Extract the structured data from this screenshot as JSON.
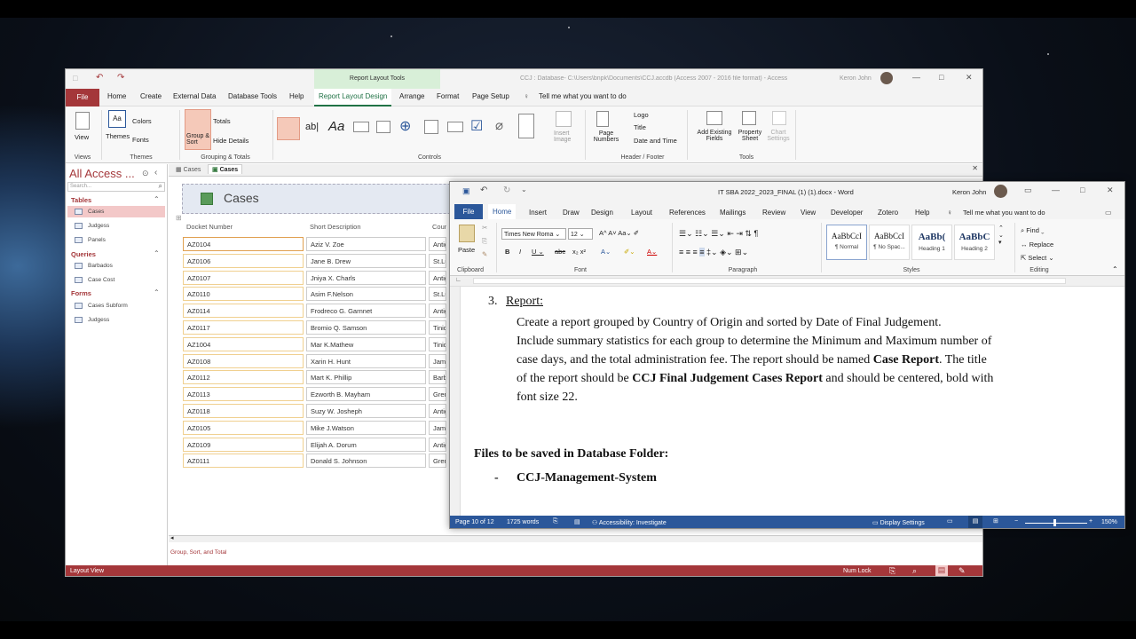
{
  "access": {
    "context_tab": "Report Layout Tools",
    "title": "CCJ : Database- C:\\Users\\bnpk\\Documents\\CCJ.accdb (Access 2007 - 2016 file format) - Access",
    "user": "Keron John",
    "tabs": [
      "File",
      "Home",
      "Create",
      "External Data",
      "Database Tools",
      "Help",
      "Report Layout Design",
      "Arrange",
      "Format",
      "Page Setup"
    ],
    "tell_me": "Tell me what you want to do",
    "ribbon": {
      "view": "View",
      "themes": "Themes",
      "colors": "Colors",
      "fonts": "Fonts",
      "group_sort": "Group & Sort",
      "totals": "Totals",
      "hide_details": "Hide Details",
      "insert_image": "Insert Image",
      "page_numbers": "Page Numbers",
      "logo": "Logo",
      "title": "Title",
      "date_time": "Date and Time",
      "add_fields": "Add Existing Fields",
      "property_sheet": "Property Sheet",
      "chart_settings": "Chart Settings",
      "groups": [
        "Views",
        "Themes",
        "Grouping & Totals",
        "Controls",
        "Header / Footer",
        "Tools"
      ]
    },
    "nav": {
      "title": "All Access ...",
      "search_placeholder": "Search...",
      "sections": [
        {
          "label": "Tables",
          "items": [
            "Cases",
            "Judgess",
            "Panels"
          ]
        },
        {
          "label": "Queries",
          "items": [
            "Barbados",
            "Case Cost"
          ]
        },
        {
          "label": "Forms",
          "items": [
            "Cases Subform",
            "Judgess"
          ]
        }
      ]
    },
    "doc_tabs": [
      "Cases",
      "Cases"
    ],
    "report": {
      "title": "Cases",
      "headers": [
        "Docket Number",
        "Short Description",
        "Coun"
      ],
      "rows": [
        [
          "AZ0104",
          "Aziz V. Zoe",
          "Antig"
        ],
        [
          "AZ0106",
          "Jane B. Drew",
          "St.Lu"
        ],
        [
          "AZ0107",
          "Jniya X. Charls",
          "Antig"
        ],
        [
          "AZ0110",
          "Asim F.Nelson",
          "St.Lu"
        ],
        [
          "AZ0114",
          "Frodreco G. Garnnet",
          "Antig"
        ],
        [
          "AZ0117",
          "Bromio Q. Samson",
          "Tinid"
        ],
        [
          "AZ1004",
          "Mar K.Mathew",
          "Tinid"
        ],
        [
          "AZ0108",
          "Xarin H. Hunt",
          "Jama"
        ],
        [
          "AZ0112",
          "Mart K. Phillip",
          "Barba"
        ],
        [
          "AZ0113",
          "Ezworth B. Mayham",
          "Gren"
        ],
        [
          "AZ0118",
          "Suzy W. Josheph",
          "Antig"
        ],
        [
          "AZ0105",
          "Mike J.Watson",
          "Jama"
        ],
        [
          "AZ0109",
          "Elijah A. Dorum",
          "Antig"
        ],
        [
          "AZ0111",
          "Donald S. Johnson",
          "Gren"
        ]
      ]
    },
    "group_sort_label": "Group, Sort, and Total",
    "status_left": "Layout View",
    "status_right": "Num Lock"
  },
  "word": {
    "title": "IT SBA 2022_2023_FINAL (1) (1).docx  -  Word",
    "user": "Keron John",
    "tabs": [
      "File",
      "Home",
      "Insert",
      "Draw",
      "Design",
      "Layout",
      "References",
      "Mailings",
      "Review",
      "View",
      "Developer",
      "Zotero",
      "Help"
    ],
    "tell_me": "Tell me what you want to do",
    "ribbon": {
      "paste": "Paste",
      "font": "Times New Roma",
      "size": "12",
      "styles": [
        {
          "sample": "AaBbCcI",
          "name": "¶ Normal"
        },
        {
          "sample": "AaBbCcI",
          "name": "¶ No Spac..."
        },
        {
          "sample": "AaBb(",
          "name": "Heading 1"
        },
        {
          "sample": "AaBbC",
          "name": "Heading 2"
        }
      ],
      "find": "Find",
      "replace": "Replace",
      "select": "Select",
      "groups": [
        "Clipboard",
        "Font",
        "Paragraph",
        "Styles",
        "Editing"
      ]
    },
    "doc": {
      "item_number": "3.",
      "item_heading": "Report:",
      "para_lines": [
        "Create a report grouped by Country of Origin and sorted by Date of Final Judgement.",
        "Include summary statistics for each group to determine the Minimum and Maximum number of",
        "case days, and the total administration fee. The report should be named ",
        "of the report should be ",
        "font size 22."
      ],
      "bold_case_report": "Case Report",
      "title_suffix": ".  The title",
      "bold_title": "CCJ Final Judgement Cases Report",
      "centered_suffix": " and should be centered, bold with",
      "files_heading": "Files to be saved in Database Folder:",
      "bullet_dash": "-",
      "bullet": "CCJ-Management-System"
    },
    "status": {
      "page": "Page 10 of 12",
      "words": "1725 words",
      "accessibility": "Accessibility: Investigate",
      "display": "Display Settings",
      "zoom": "150%"
    }
  },
  "colors": {
    "access_red": "#a4373a",
    "word_blue": "#2b579a",
    "ctx_green": "#d8efd8"
  }
}
